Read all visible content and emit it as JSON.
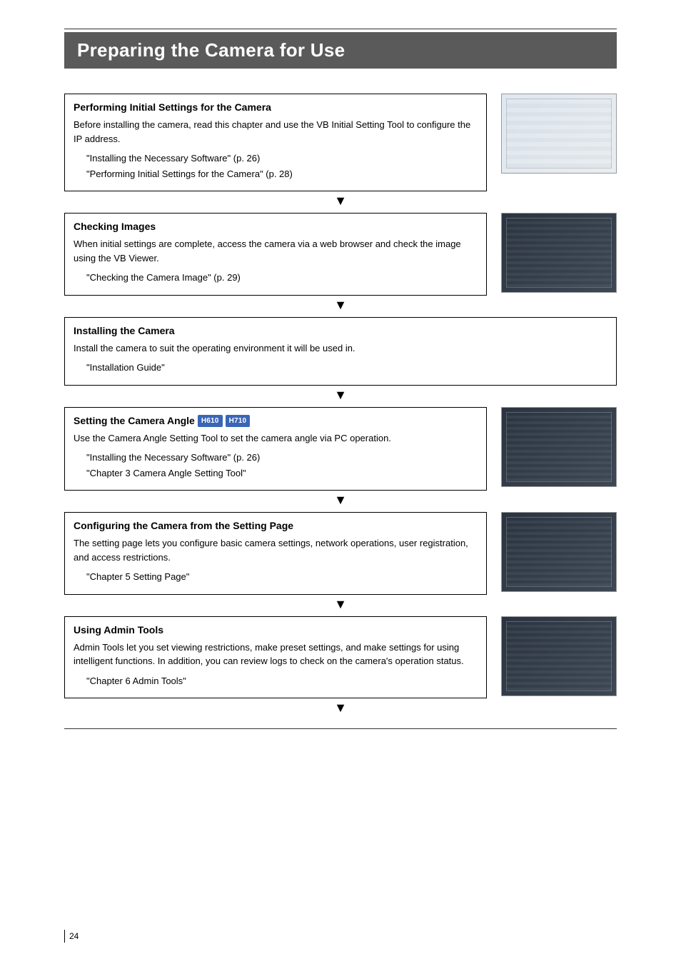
{
  "page_title": "Preparing the Camera for Use",
  "page_number": "24",
  "arrow_glyph": "▼",
  "steps": [
    {
      "heading": "Performing Initial Settings for the Camera",
      "body": "Before installing the camera, read this chapter and use the VB Initial Setting Tool to configure the IP address.",
      "refs": [
        "\"Installing the Necessary Software\" (p. 26)",
        "\"Performing Initial Settings for the Camera\" (p. 28)"
      ],
      "thumb_style": "light",
      "badges": []
    },
    {
      "heading": "Checking Images",
      "body": "When initial settings are complete, access the camera via a web browser and check the image using the VB Viewer.",
      "refs": [
        "\"Checking the Camera Image\" (p. 29)"
      ],
      "thumb_style": "dark",
      "badges": []
    },
    {
      "heading": "Installing the Camera",
      "body": "Install the camera to suit the operating environment it will be used in.",
      "refs": [
        "\"Installation Guide\""
      ],
      "thumb_style": "none",
      "badges": []
    },
    {
      "heading": "Setting the Camera Angle",
      "body": "Use the Camera Angle Setting Tool to set the camera angle via PC operation.",
      "refs": [
        "\"Installing the Necessary Software\" (p. 26)",
        "\"Chapter 3 Camera Angle Setting Tool\""
      ],
      "thumb_style": "dark",
      "badges": [
        "H610",
        "H710"
      ]
    },
    {
      "heading": "Configuring the Camera from the Setting Page",
      "body": "The setting page lets you configure basic camera settings, network operations, user registration, and access restrictions.",
      "refs": [
        "\"Chapter 5 Setting Page\""
      ],
      "thumb_style": "dark",
      "badges": []
    },
    {
      "heading": "Using Admin Tools",
      "body": "Admin Tools let you set viewing restrictions, make preset settings, and make settings for using intelligent functions. In addition, you can review logs to check on the camera's operation status.",
      "refs": [
        "\"Chapter 6 Admin Tools\""
      ],
      "thumb_style": "dark",
      "badges": []
    }
  ]
}
